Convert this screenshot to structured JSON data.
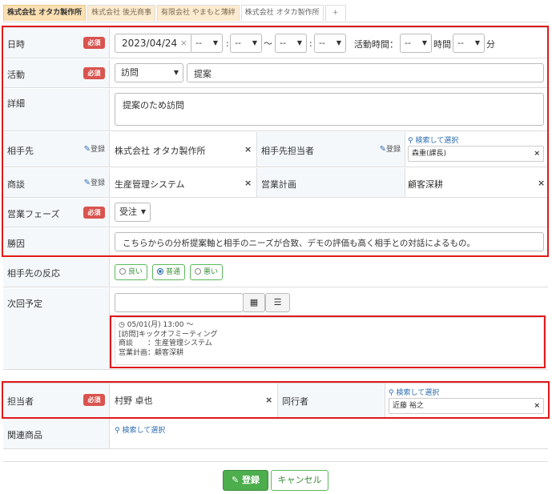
{
  "tabs": [
    {
      "label": "株式会社 オタカ製作所"
    },
    {
      "label": "株式会社 後光商事"
    },
    {
      "label": "有限会社 やまもと薄絆"
    },
    {
      "label": "株式会社 オタカ製作所"
    },
    {
      "label": "+"
    }
  ],
  "required_label": "必須",
  "register_label": "登録",
  "search_select_label": "検索して選択",
  "clear_symbol": "×",
  "fields": {
    "datetime": {
      "label": "日時",
      "date": "2023/04/24",
      "date_clear": "×",
      "hour_start": "--",
      "min_start": "--",
      "colon": ":",
      "tilde": "～",
      "hour_end": "--",
      "min_end": "--",
      "duration_label": "活動時間：",
      "duration_hours": "--",
      "hours_unit": "時間",
      "duration_minutes": "--",
      "minutes_unit": "分"
    },
    "activity": {
      "label": "活動",
      "type": "訪問",
      "detail": "提案"
    },
    "details": {
      "label": "詳細",
      "value": "提案のため訪問"
    },
    "partner": {
      "label": "相手先",
      "value": "株式会社 オタカ製作所"
    },
    "partner_contact": {
      "label": "相手先担当者",
      "value": "森重(課長)"
    },
    "deal": {
      "label": "商談",
      "value": "生産管理システム"
    },
    "sales_plan": {
      "label": "営業計画",
      "value": "顧客深耕"
    },
    "phase": {
      "label": "営業フェーズ",
      "value": "受注"
    },
    "win_factor": {
      "label": "勝因",
      "value": "こちらからの分析提案軸と相手のニーズが合致、デモの評価も高く相手との対話によるもの。"
    },
    "reaction": {
      "label": "相手先の反応",
      "options": [
        "良い",
        "普通",
        "悪い"
      ],
      "selected": "普通"
    },
    "next_plan": {
      "label": "次回予定",
      "datetime": "05/01(月) 13:00 ～",
      "title": "[訪問]キックオフミーティング",
      "deal_line": "商談　　：生産管理システム",
      "plan_line": "営業計画：顧客深耕"
    },
    "owner": {
      "label": "担当者",
      "value": "村野 卓也"
    },
    "companion": {
      "label": "同行者",
      "value": "近藤 裕之"
    },
    "related_products": {
      "label": "関連商品"
    }
  },
  "actions": {
    "submit": "登録",
    "cancel": "キャンセル"
  },
  "colors": {
    "required": "#d9534f",
    "submit": "#4cae4c",
    "highlight": "#e01919",
    "link": "#2b6cb0"
  }
}
